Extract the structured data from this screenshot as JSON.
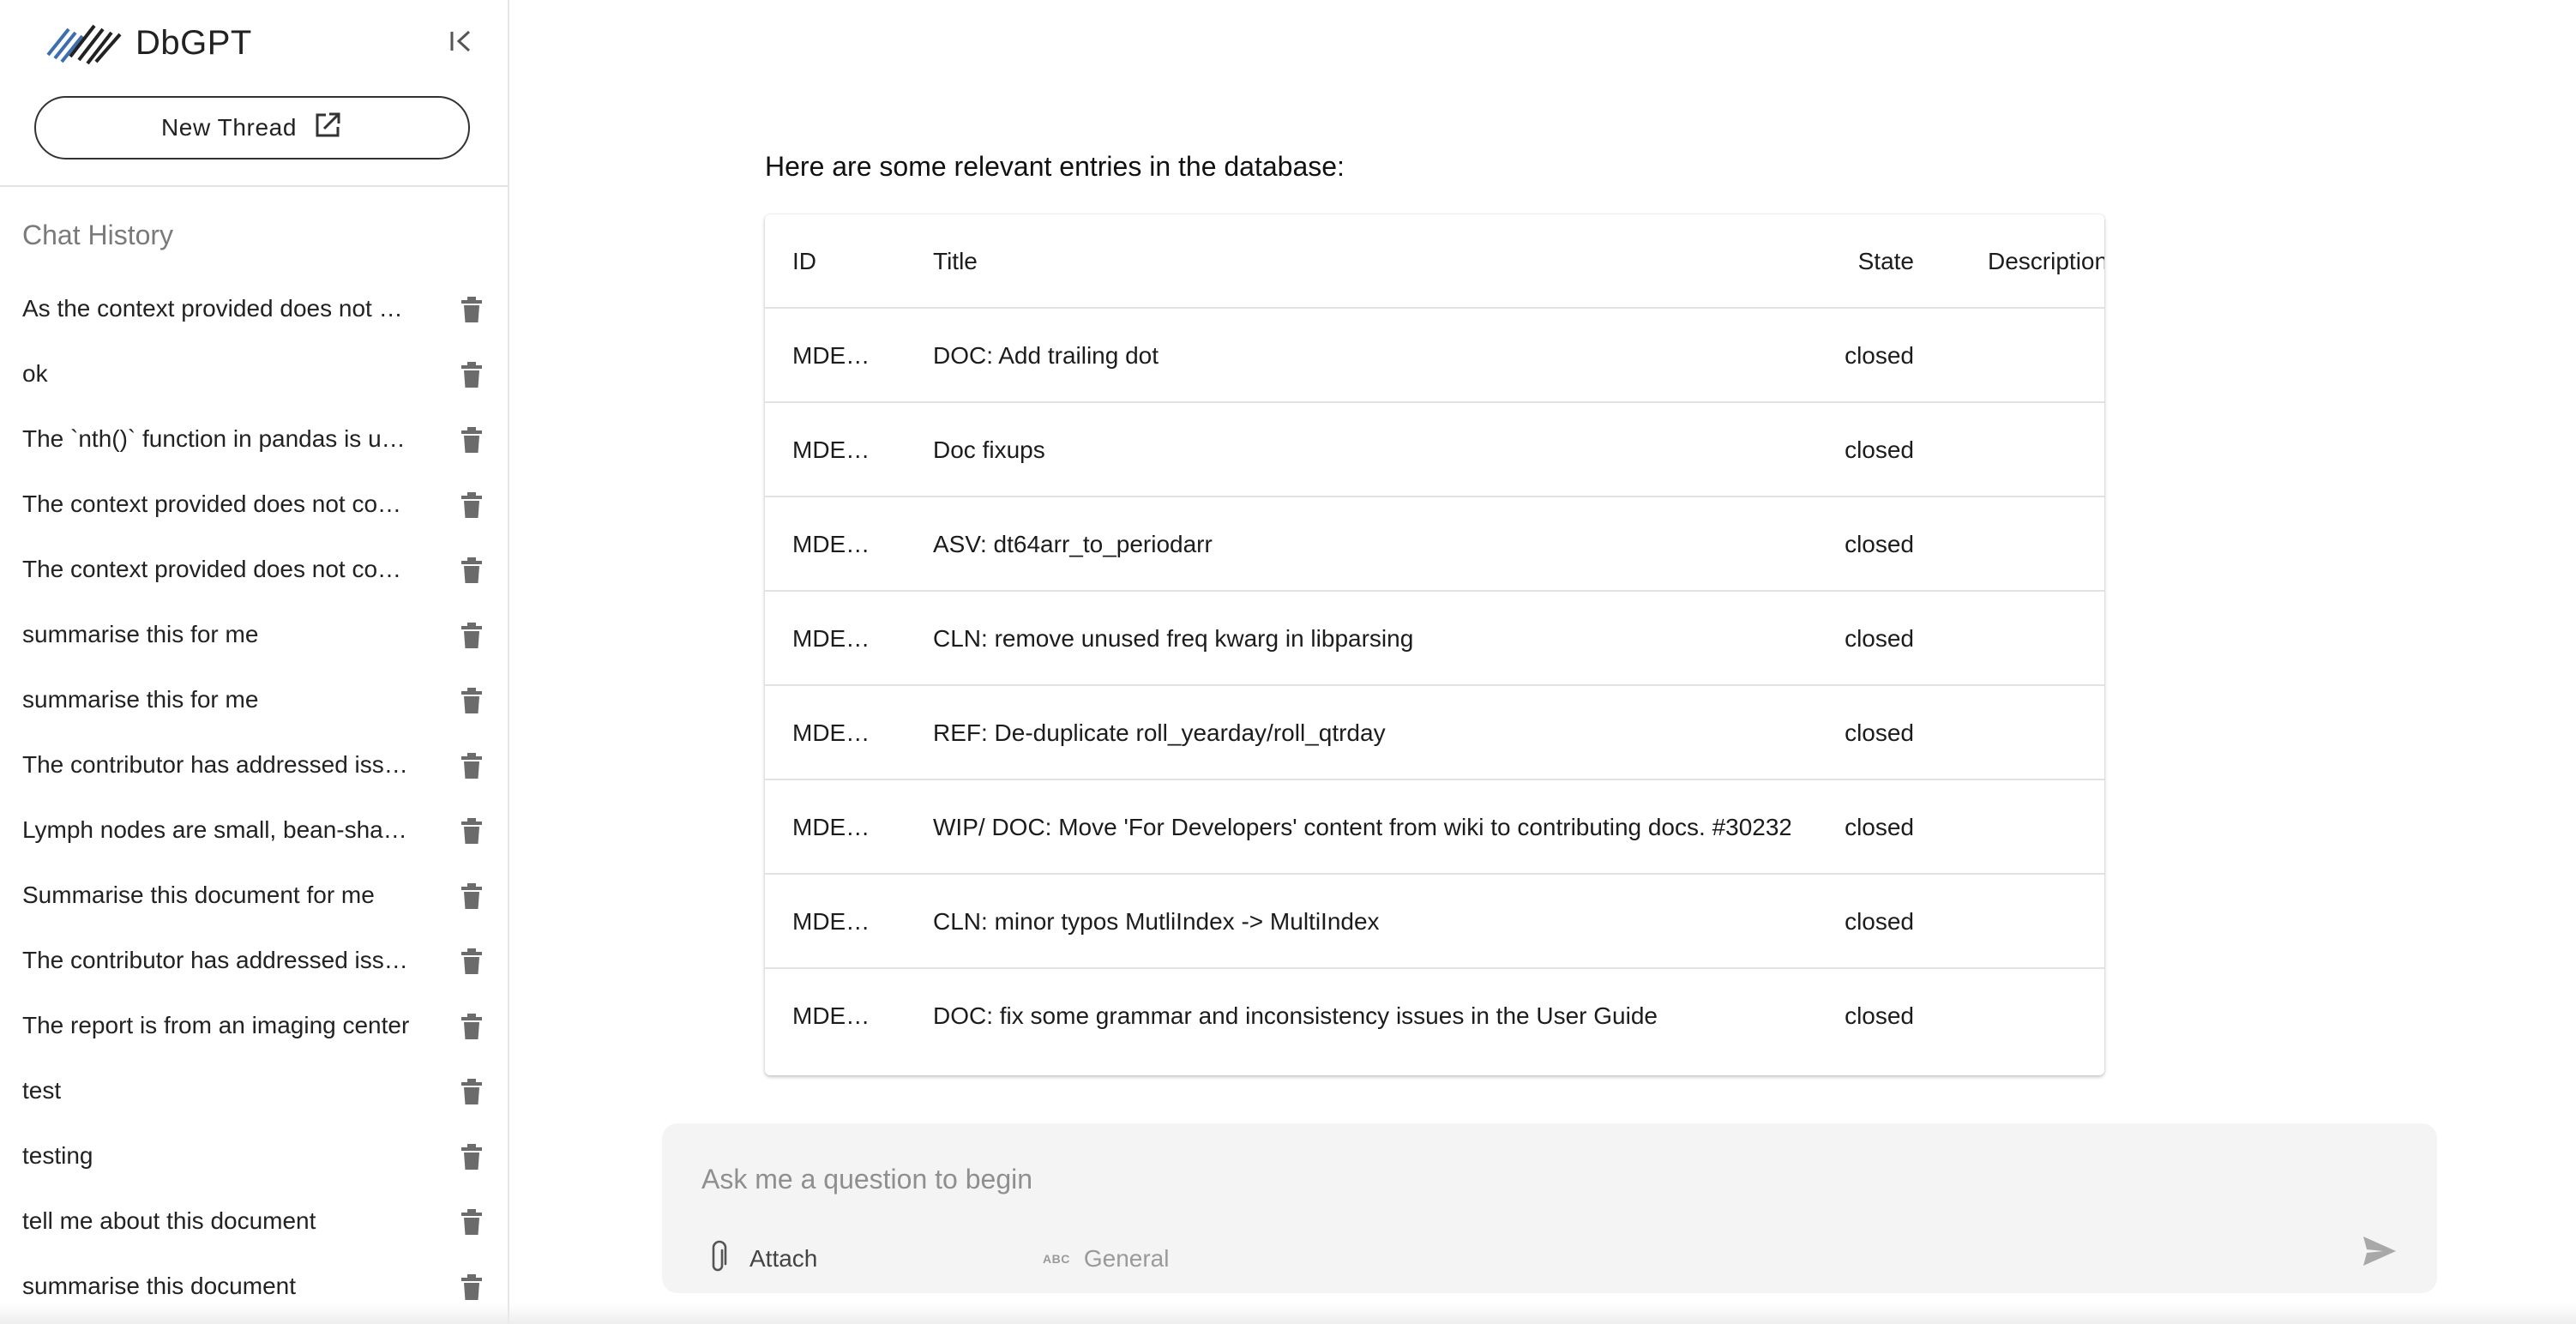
{
  "app": {
    "name": "DbGPT"
  },
  "sidebar": {
    "new_thread_label": "New Thread",
    "history_title": "Chat History",
    "history": [
      "As the context provided does not contain",
      "ok",
      "The `nth()` function in pandas is used to",
      "The context provided does not contain",
      "The context provided does not contain",
      "summarise this for me",
      "summarise this for me",
      "The contributor has addressed issues",
      "Lymph nodes are small, bean-shaped",
      "Summarise this document for me",
      "The contributor has addressed issues",
      "The report is from an imaging center",
      "test",
      "testing",
      "tell me about this document",
      "summarise this document"
    ]
  },
  "main": {
    "intro": "Here are some relevant entries in the database:",
    "table": {
      "columns": {
        "id": "ID",
        "title": "Title",
        "state": "State",
        "description": "Description"
      },
      "rows": [
        {
          "id": "MDE…",
          "title": "DOC: Add trailing dot",
          "state": "closed"
        },
        {
          "id": "MDE…",
          "title": "Doc fixups",
          "state": "closed"
        },
        {
          "id": "MDE…",
          "title": "ASV: dt64arr_to_periodarr",
          "state": "closed"
        },
        {
          "id": "MDE…",
          "title": "CLN: remove unused freq kwarg in libparsing",
          "state": "closed"
        },
        {
          "id": "MDE…",
          "title": "REF: De-duplicate roll_yearday/roll_qtrday",
          "state": "closed"
        },
        {
          "id": "MDE…",
          "title": "WIP/ DOC: Move 'For Developers' content from wiki to contributing docs. #30232",
          "state": "closed"
        },
        {
          "id": "MDE…",
          "title": "CLN: minor typos MutliIndex -> MultiIndex",
          "state": "closed"
        },
        {
          "id": "MDE…",
          "title": "DOC: fix some grammar and inconsistency issues in the User Guide",
          "state": "closed"
        }
      ]
    }
  },
  "composer": {
    "placeholder": "Ask me a question to begin",
    "attach_label": "Attach",
    "mode_icon_text": "ABC",
    "mode_label": "General"
  },
  "icons": {
    "logo": "dbgpt-logo-icon",
    "collapse": "collapse-sidebar-icon",
    "new_thread": "open-in-new-icon",
    "delete": "trash-icon",
    "attach": "paperclip-icon",
    "send": "send-icon"
  },
  "colors": {
    "logo_blue": "#3d6fb0",
    "logo_dark": "#222222",
    "input_bg": "#f4f4f4"
  }
}
